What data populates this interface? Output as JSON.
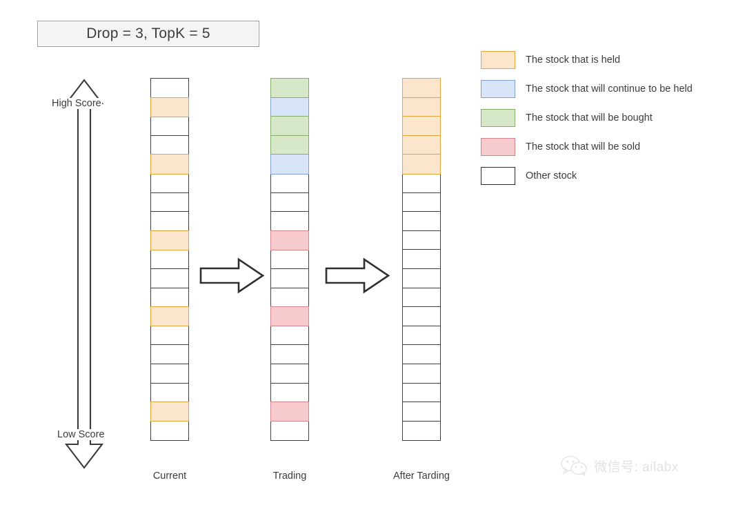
{
  "title": {
    "label": "Drop = 3, TopK = 5"
  },
  "axis": {
    "high_label": "High Score",
    "low_label": "Low Score",
    "direction_icon": "double-vertical-arrow-icon"
  },
  "colors": {
    "held_fill": "#fce5cd",
    "held_border": "#e5a33c",
    "continue_fill": "#d8e5f8",
    "continue_border": "#7fa0cc",
    "buy_fill": "#d6e8c8",
    "buy_border": "#82ab6a",
    "sell_fill": "#f7cacd",
    "sell_border": "#d28489",
    "other_fill": "#ffffff",
    "other_border": "#3f3f3f",
    "title_box_fill": "#f4f4f4",
    "title_box_border": "#9a9a9a"
  },
  "columns": [
    {
      "id": "current",
      "label": "Current",
      "cells": [
        "white",
        "orange",
        "white",
        "white",
        "orange",
        "white",
        "white",
        "white",
        "orange",
        "white",
        "white",
        "white",
        "orange",
        "white",
        "white",
        "white",
        "white",
        "orange",
        "white"
      ]
    },
    {
      "id": "trading",
      "label": "Trading",
      "cells": [
        "green",
        "blue",
        "green",
        "green",
        "blue",
        "white",
        "white",
        "white",
        "red",
        "white",
        "white",
        "white",
        "red",
        "white",
        "white",
        "white",
        "white",
        "red",
        "white"
      ]
    },
    {
      "id": "after-trading",
      "label": "After Tarding",
      "cells": [
        "orange",
        "orange",
        "orange",
        "orange",
        "orange",
        "white",
        "white",
        "white",
        "white",
        "white",
        "white",
        "white",
        "white",
        "white",
        "white",
        "white",
        "white",
        "white",
        "white"
      ]
    }
  ],
  "flow_arrows": [
    {
      "id": "arrow-current-to-trading",
      "icon": "arrow-right-icon"
    },
    {
      "id": "arrow-trading-to-after",
      "icon": "arrow-right-icon"
    }
  ],
  "legend": {
    "items": [
      {
        "swatch": "orange",
        "label": "The stock that is held"
      },
      {
        "swatch": "blue",
        "label": "The stock that will continue to be held"
      },
      {
        "swatch": "green",
        "label": "The stock that will be bought"
      },
      {
        "swatch": "red",
        "label": "The stock that will be sold"
      },
      {
        "swatch": "white",
        "label": "Other stock"
      }
    ]
  },
  "watermark": {
    "icon": "wechat-icon",
    "text": "微信号: ailabx"
  }
}
